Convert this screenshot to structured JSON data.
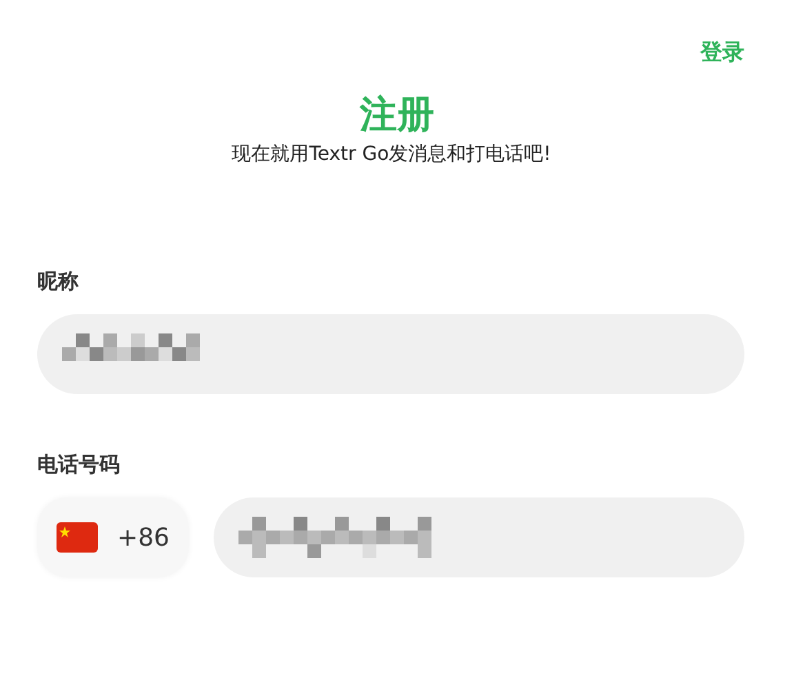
{
  "login_link": "登录",
  "title": "注册",
  "subtitle": "现在就用Textr Go发消息和打电话吧!",
  "fields": [
    {
      "kind": "text",
      "label": "昵称"
    },
    {
      "kind": "phone",
      "label": "电话号码",
      "country_code": "+86"
    }
  ]
}
